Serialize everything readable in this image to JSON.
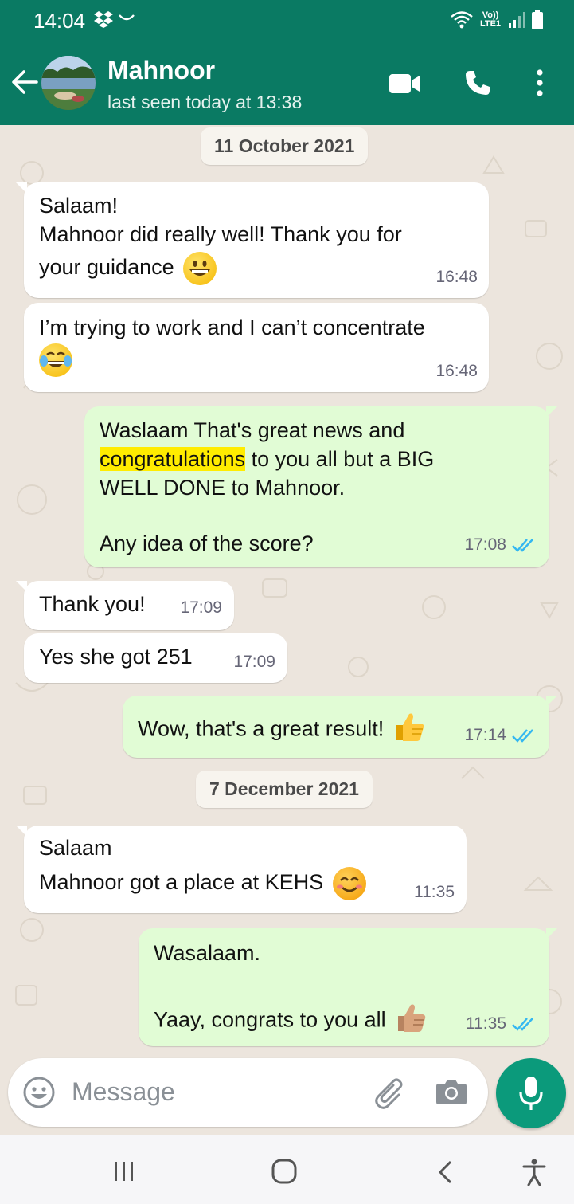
{
  "status_bar": {
    "time": "14:04",
    "network_label": "Vo)) LTE1"
  },
  "header": {
    "contact_name": "Mahnoor",
    "last_seen": "last seen today at 13:38"
  },
  "chat": {
    "date_1": "11 October 2021",
    "date_2": "7 December 2021",
    "messages": [
      {
        "lines": [
          "Salaam!",
          "Mahnoor did really well! Thank you for",
          "your guidance"
        ],
        "time": "16:48",
        "emoji": "grinning-face"
      },
      {
        "lines": [
          "I’m trying to work and I can’t concentrate"
        ],
        "time": "16:48",
        "emoji": "tears-of-joy-face"
      },
      {
        "line1_pre": "Waslaam That's great news and",
        "highlight": "congratulations",
        "line2_post": " to you all but a BIG",
        "line3": "WELL DONE to Mahnoor.",
        "line4": "Any idea of the score?",
        "time": "17:08"
      },
      {
        "text": "Thank you!",
        "time": "17:09"
      },
      {
        "text": "Yes she got 251",
        "time": "17:09"
      },
      {
        "text": "Wow, that's a great result!",
        "time": "17:14",
        "emoji": "thumbs-up"
      },
      {
        "lines": [
          "Salaam",
          "Mahnoor got a place at KEHS"
        ],
        "time": "11:35",
        "emoji": "smiling-face"
      },
      {
        "lines": [
          "Wasalaam.",
          "Yaay, congrats to you all"
        ],
        "time": "11:35",
        "emoji": "thumbs-up-medium-skin"
      }
    ]
  },
  "input": {
    "placeholder": "Message"
  },
  "colors": {
    "header": "#0a7a63",
    "incoming": "#ffffff",
    "outgoing": "#e1fcd5",
    "read_ticks": "#34b7f1",
    "highlight": "#ffec00",
    "mic": "#0b9a7b"
  }
}
